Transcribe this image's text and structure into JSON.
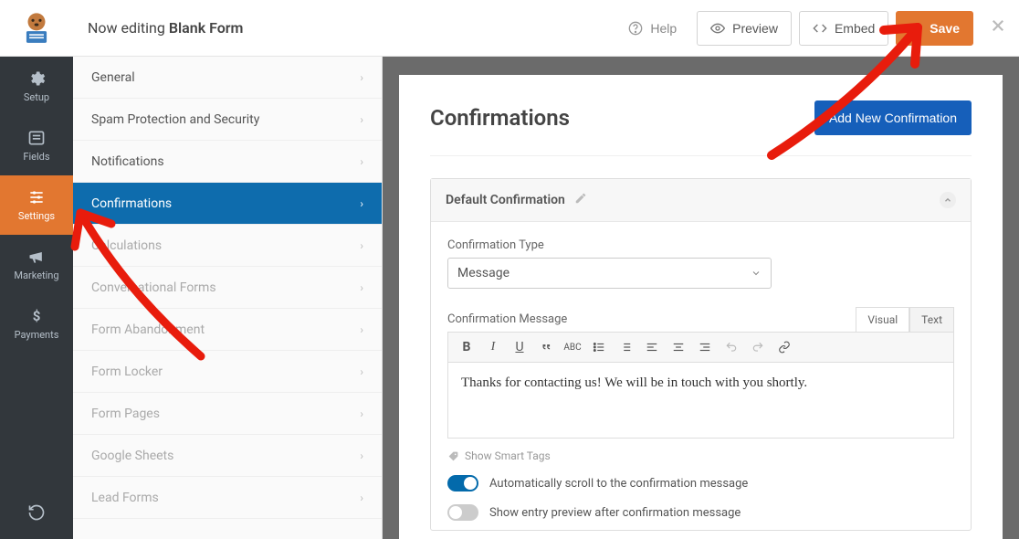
{
  "topbar": {
    "editing_prefix": "Now editing ",
    "form_name": "Blank Form",
    "help": "Help",
    "preview": "Preview",
    "embed": "Embed",
    "save": "Save"
  },
  "nav": {
    "setup": "Setup",
    "fields": "Fields",
    "settings": "Settings",
    "marketing": "Marketing",
    "payments": "Payments"
  },
  "sidebar": {
    "items": [
      {
        "label": "General",
        "state": "normal"
      },
      {
        "label": "Spam Protection and Security",
        "state": "normal"
      },
      {
        "label": "Notifications",
        "state": "normal"
      },
      {
        "label": "Confirmations",
        "state": "active"
      },
      {
        "label": "Calculations",
        "state": "faded"
      },
      {
        "label": "Conversational Forms",
        "state": "faded"
      },
      {
        "label": "Form Abandonment",
        "state": "faded"
      },
      {
        "label": "Form Locker",
        "state": "faded"
      },
      {
        "label": "Form Pages",
        "state": "faded"
      },
      {
        "label": "Google Sheets",
        "state": "faded"
      },
      {
        "label": "Lead Forms",
        "state": "faded"
      }
    ]
  },
  "main": {
    "title": "Confirmations",
    "add_button": "Add New Confirmation",
    "confirmation": {
      "name": "Default Confirmation",
      "type_label": "Confirmation Type",
      "type_value": "Message",
      "message_label": "Confirmation Message",
      "tabs": {
        "visual": "Visual",
        "text": "Text"
      },
      "message_body": "Thanks for contacting us! We will be in touch with you shortly.",
      "smart_tags": "Show Smart Tags",
      "toggle_autoscroll": "Automatically scroll to the confirmation message",
      "toggle_entry_preview": "Show entry preview after confirmation message"
    }
  }
}
